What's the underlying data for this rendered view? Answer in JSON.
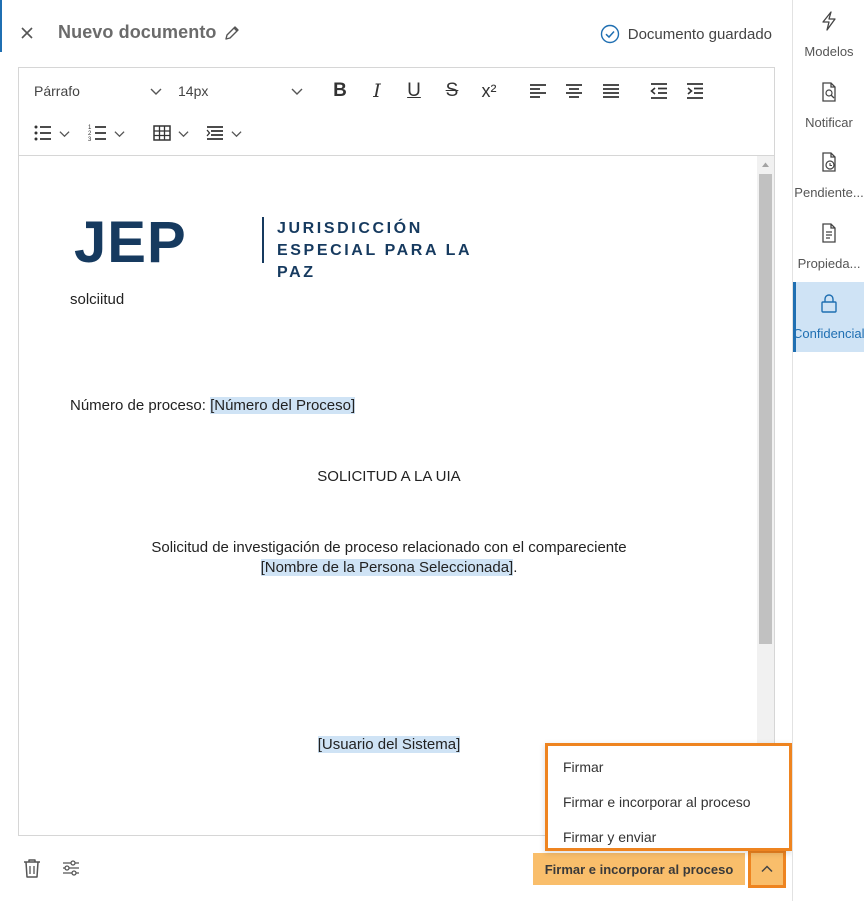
{
  "header": {
    "title": "Nuevo documento",
    "saved_status": "Documento guardado"
  },
  "toolbar": {
    "paragraph_select": "Párrafo",
    "size_select": "14px",
    "bold": "B",
    "italic": "I",
    "underline": "U",
    "strike": "S",
    "superscript": "x²"
  },
  "document": {
    "logo_letters": "JEP",
    "logo_tagline_1": "JURISDICCIÓN",
    "logo_tagline_2": "ESPECIAL PARA LA PAZ",
    "line_request": "solciitud",
    "process_label": "Número de proceso: ",
    "process_placeholder": "[Número del Proceso]",
    "heading": "SOLICITUD A LA UIA",
    "body_line_1": "Solicitud  de investigación de proceso  relacionado  con  el  compareciente",
    "body_placeholder": "[Nombre de la Persona Seleccionada]",
    "body_end": ".",
    "user_placeholder": "[Usuario del Sistema]"
  },
  "menu": {
    "items": [
      "Firmar",
      "Firmar e incorporar al proceso",
      "Firmar y enviar"
    ]
  },
  "footer": {
    "primary_label": "Firmar e incorporar al proceso"
  },
  "sidebar": {
    "items": [
      {
        "label": "Modelos",
        "icon": "lightning-icon"
      },
      {
        "label": "Notificar",
        "icon": "notify-doc-icon"
      },
      {
        "label": "Pendiente...",
        "icon": "pending-doc-icon"
      },
      {
        "label": "Propieda...",
        "icon": "properties-doc-icon"
      },
      {
        "label": "Confidencial",
        "icon": "lock-icon"
      }
    ]
  },
  "colors": {
    "accent_orange": "#ee8420",
    "button_orange": "#f9be6b",
    "active_blue": "#1f6fb2",
    "highlight": "#cfe3f5",
    "logo_navy": "#163a5f"
  }
}
